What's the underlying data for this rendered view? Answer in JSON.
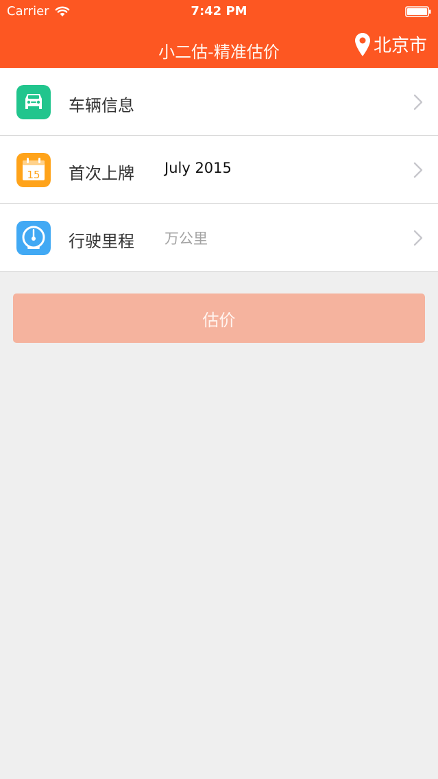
{
  "status_bar": {
    "carrier": "Carrier",
    "time": "7:42 PM"
  },
  "nav": {
    "title": "小二估-精准估价",
    "city": "北京市"
  },
  "rows": [
    {
      "label": "车辆信息",
      "value": "",
      "icon": "car-icon",
      "icon_color": "#21c58d"
    },
    {
      "label": "首次上牌",
      "value": "July 2015",
      "icon": "calendar-icon",
      "icon_color": "#ffa31a"
    },
    {
      "label": "行驶里程",
      "value": "万公里",
      "icon": "speedometer-icon",
      "icon_color": "#41a9f4"
    }
  ],
  "calendar_day": "15",
  "button": {
    "label": "估价"
  },
  "colors": {
    "brand": "#fd5722",
    "button_disabled": "#f5b39e",
    "background": "#efefef"
  }
}
